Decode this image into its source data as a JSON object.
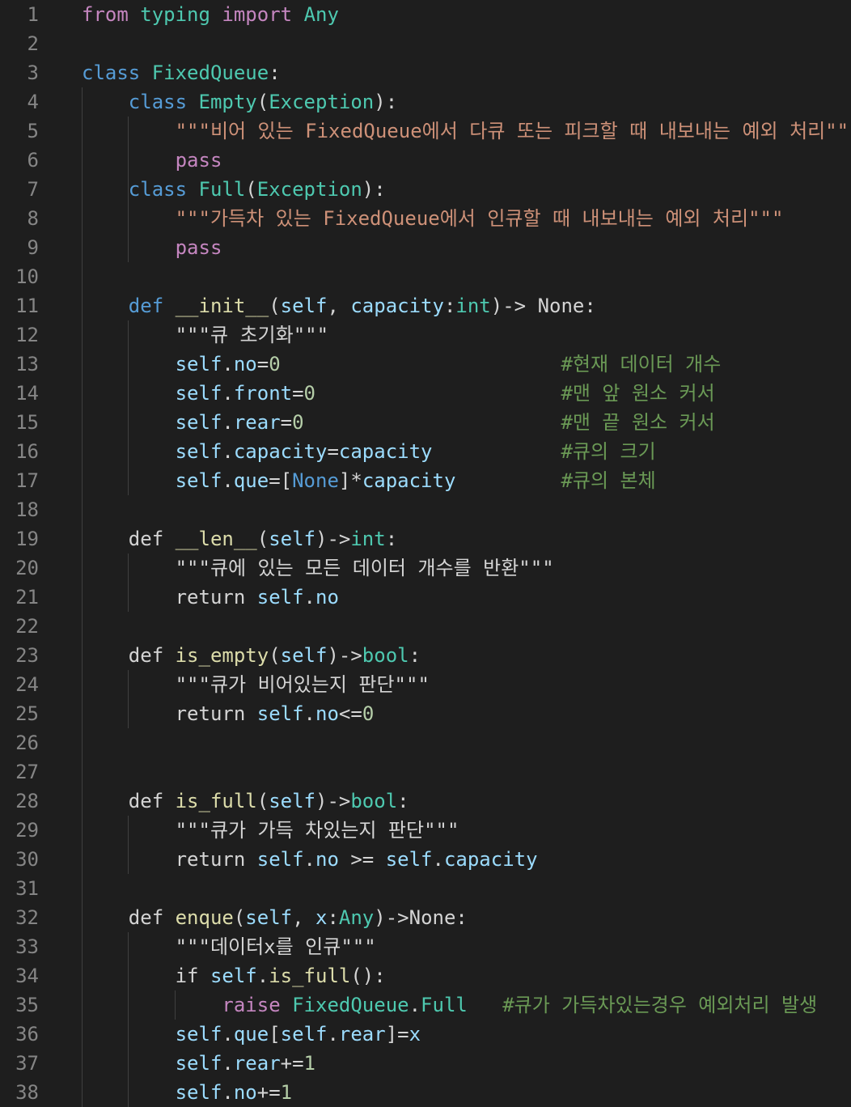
{
  "editor": {
    "colors": {
      "background": "#1e1e1e",
      "line_number": "#858585",
      "keyword_control": "#c586c0",
      "keyword": "#569cd6",
      "class_name": "#4ec9b0",
      "function_name": "#dcdcaa",
      "string": "#ce9178",
      "variable": "#9cdcfe",
      "number": "#b5cea8",
      "comment": "#6a9955",
      "default_text": "#d4d4d4"
    },
    "lines": [
      {
        "n": "1",
        "tokens": [
          [
            "kw-ctrl",
            "from"
          ],
          [
            "plain",
            " "
          ],
          [
            "cls",
            "typing"
          ],
          [
            "plain",
            " "
          ],
          [
            "kw-ctrl",
            "import"
          ],
          [
            "plain",
            " "
          ],
          [
            "cls",
            "Any"
          ]
        ]
      },
      {
        "n": "2",
        "tokens": []
      },
      {
        "n": "3",
        "tokens": [
          [
            "kw",
            "class"
          ],
          [
            "plain",
            " "
          ],
          [
            "cls",
            "FixedQueue"
          ],
          [
            "plain",
            ":"
          ]
        ]
      },
      {
        "n": "4",
        "tokens": [
          [
            "plain",
            "    "
          ],
          [
            "kw",
            "class"
          ],
          [
            "plain",
            " "
          ],
          [
            "cls",
            "Empty"
          ],
          [
            "plain",
            "("
          ],
          [
            "cls",
            "Exception"
          ],
          [
            "plain",
            "):"
          ]
        ]
      },
      {
        "n": "5",
        "tokens": [
          [
            "plain",
            "        "
          ],
          [
            "str",
            "\"\"\"비어 있는 FixedQueue에서 다큐 또는 피크할 때 내보내는 예외 처리\"\"\""
          ]
        ]
      },
      {
        "n": "6",
        "tokens": [
          [
            "plain",
            "        "
          ],
          [
            "kw-ctrl",
            "pass"
          ]
        ]
      },
      {
        "n": "7",
        "tokens": [
          [
            "plain",
            "    "
          ],
          [
            "kw",
            "class"
          ],
          [
            "plain",
            " "
          ],
          [
            "cls",
            "Full"
          ],
          [
            "plain",
            "("
          ],
          [
            "cls",
            "Exception"
          ],
          [
            "plain",
            "):"
          ]
        ]
      },
      {
        "n": "8",
        "tokens": [
          [
            "plain",
            "        "
          ],
          [
            "str",
            "\"\"\"가득차 있는 FixedQueue에서 인큐할 때 내보내는 예외 처리\"\"\""
          ]
        ]
      },
      {
        "n": "9",
        "tokens": [
          [
            "plain",
            "        "
          ],
          [
            "kw-ctrl",
            "pass"
          ]
        ]
      },
      {
        "n": "10",
        "tokens": []
      },
      {
        "n": "11",
        "tokens": [
          [
            "plain",
            "    "
          ],
          [
            "kw",
            "def"
          ],
          [
            "plain",
            " "
          ],
          [
            "fn",
            "__init__"
          ],
          [
            "plain",
            "("
          ],
          [
            "var",
            "self"
          ],
          [
            "plain",
            ", "
          ],
          [
            "var",
            "capacity"
          ],
          [
            "plain",
            ":"
          ],
          [
            "cls",
            "int"
          ],
          [
            "plain",
            ")-> None:"
          ]
        ]
      },
      {
        "n": "12",
        "tokens": [
          [
            "plain",
            "        "
          ],
          [
            "plain",
            "\"\"\"큐 초기화\"\"\""
          ]
        ]
      },
      {
        "n": "13",
        "tokens": [
          [
            "plain",
            "        "
          ],
          [
            "var",
            "self"
          ],
          [
            "plain",
            "."
          ],
          [
            "var",
            "no"
          ],
          [
            "plain",
            "="
          ],
          [
            "num",
            "0"
          ],
          [
            "plain",
            "                        "
          ],
          [
            "cmt",
            "#현재 데이터 개수"
          ]
        ]
      },
      {
        "n": "14",
        "tokens": [
          [
            "plain",
            "        "
          ],
          [
            "var",
            "self"
          ],
          [
            "plain",
            "."
          ],
          [
            "var",
            "front"
          ],
          [
            "plain",
            "="
          ],
          [
            "num",
            "0"
          ],
          [
            "plain",
            "                     "
          ],
          [
            "cmt",
            "#맨 앞 원소 커서"
          ]
        ]
      },
      {
        "n": "15",
        "tokens": [
          [
            "plain",
            "        "
          ],
          [
            "var",
            "self"
          ],
          [
            "plain",
            "."
          ],
          [
            "var",
            "rear"
          ],
          [
            "plain",
            "="
          ],
          [
            "num",
            "0"
          ],
          [
            "plain",
            "                      "
          ],
          [
            "cmt",
            "#맨 끝 원소 커서"
          ]
        ]
      },
      {
        "n": "16",
        "tokens": [
          [
            "plain",
            "        "
          ],
          [
            "var",
            "self"
          ],
          [
            "plain",
            "."
          ],
          [
            "var",
            "capacity"
          ],
          [
            "plain",
            "="
          ],
          [
            "var",
            "capacity"
          ],
          [
            "plain",
            "           "
          ],
          [
            "cmt",
            "#큐의 크기"
          ]
        ]
      },
      {
        "n": "17",
        "tokens": [
          [
            "plain",
            "        "
          ],
          [
            "var",
            "self"
          ],
          [
            "plain",
            "."
          ],
          [
            "var",
            "que"
          ],
          [
            "plain",
            "=["
          ],
          [
            "kw",
            "None"
          ],
          [
            "plain",
            "]*"
          ],
          [
            "var",
            "capacity"
          ],
          [
            "plain",
            "         "
          ],
          [
            "cmt",
            "#큐의 본체"
          ]
        ]
      },
      {
        "n": "18",
        "tokens": []
      },
      {
        "n": "19",
        "tokens": [
          [
            "plain",
            "    "
          ],
          [
            "plain",
            "def "
          ],
          [
            "fn",
            "__len__"
          ],
          [
            "plain",
            "("
          ],
          [
            "var",
            "self"
          ],
          [
            "plain",
            ")->"
          ],
          [
            "cls",
            "int"
          ],
          [
            "plain",
            ":"
          ]
        ]
      },
      {
        "n": "20",
        "tokens": [
          [
            "plain",
            "        "
          ],
          [
            "plain",
            "\"\"\"큐에 있는 모든 데이터 개수를 반환\"\"\""
          ]
        ]
      },
      {
        "n": "21",
        "tokens": [
          [
            "plain",
            "        "
          ],
          [
            "plain",
            "return "
          ],
          [
            "var",
            "self"
          ],
          [
            "plain",
            "."
          ],
          [
            "var",
            "no"
          ]
        ]
      },
      {
        "n": "22",
        "tokens": []
      },
      {
        "n": "23",
        "tokens": [
          [
            "plain",
            "    "
          ],
          [
            "plain",
            "def "
          ],
          [
            "fn",
            "is_empty"
          ],
          [
            "plain",
            "("
          ],
          [
            "var",
            "self"
          ],
          [
            "plain",
            ")->"
          ],
          [
            "cls",
            "bool"
          ],
          [
            "plain",
            ":"
          ]
        ]
      },
      {
        "n": "24",
        "tokens": [
          [
            "plain",
            "        "
          ],
          [
            "plain",
            "\"\"\"큐가 비어있는지 판단\"\"\""
          ]
        ]
      },
      {
        "n": "25",
        "tokens": [
          [
            "plain",
            "        "
          ],
          [
            "plain",
            "return "
          ],
          [
            "var",
            "self"
          ],
          [
            "plain",
            "."
          ],
          [
            "var",
            "no"
          ],
          [
            "plain",
            "<="
          ],
          [
            "num",
            "0"
          ]
        ]
      },
      {
        "n": "26",
        "tokens": []
      },
      {
        "n": "27",
        "tokens": []
      },
      {
        "n": "28",
        "tokens": [
          [
            "plain",
            "    "
          ],
          [
            "plain",
            "def "
          ],
          [
            "fn",
            "is_full"
          ],
          [
            "plain",
            "("
          ],
          [
            "var",
            "self"
          ],
          [
            "plain",
            ")->"
          ],
          [
            "cls",
            "bool"
          ],
          [
            "plain",
            ":"
          ]
        ]
      },
      {
        "n": "29",
        "tokens": [
          [
            "plain",
            "        "
          ],
          [
            "plain",
            "\"\"\"큐가 가득 차있는지 판단\"\"\""
          ]
        ]
      },
      {
        "n": "30",
        "tokens": [
          [
            "plain",
            "        "
          ],
          [
            "plain",
            "return "
          ],
          [
            "var",
            "self"
          ],
          [
            "plain",
            "."
          ],
          [
            "var",
            "no"
          ],
          [
            "plain",
            " >= "
          ],
          [
            "var",
            "self"
          ],
          [
            "plain",
            "."
          ],
          [
            "var",
            "capacity"
          ]
        ]
      },
      {
        "n": "31",
        "tokens": []
      },
      {
        "n": "32",
        "tokens": [
          [
            "plain",
            "    "
          ],
          [
            "plain",
            "def "
          ],
          [
            "fn",
            "enque"
          ],
          [
            "plain",
            "("
          ],
          [
            "var",
            "self"
          ],
          [
            "plain",
            ", "
          ],
          [
            "var",
            "x"
          ],
          [
            "plain",
            ":"
          ],
          [
            "cls",
            "Any"
          ],
          [
            "plain",
            ")->None:"
          ]
        ]
      },
      {
        "n": "33",
        "tokens": [
          [
            "plain",
            "        "
          ],
          [
            "plain",
            "\"\"\"데이터x를 인큐\"\"\""
          ]
        ]
      },
      {
        "n": "34",
        "tokens": [
          [
            "plain",
            "        "
          ],
          [
            "plain",
            "if "
          ],
          [
            "var",
            "self"
          ],
          [
            "plain",
            "."
          ],
          [
            "fn",
            "is_full"
          ],
          [
            "plain",
            "():"
          ]
        ]
      },
      {
        "n": "35",
        "tokens": [
          [
            "plain",
            "            "
          ],
          [
            "kw-ctrl",
            "raise"
          ],
          [
            "plain",
            " "
          ],
          [
            "cls",
            "FixedQueue"
          ],
          [
            "plain",
            "."
          ],
          [
            "cls",
            "Full"
          ],
          [
            "plain",
            "   "
          ],
          [
            "cmt",
            "#큐가 가득차있는경우 예외처리 발생"
          ]
        ]
      },
      {
        "n": "36",
        "tokens": [
          [
            "plain",
            "        "
          ],
          [
            "var",
            "self"
          ],
          [
            "plain",
            "."
          ],
          [
            "var",
            "que"
          ],
          [
            "plain",
            "["
          ],
          [
            "var",
            "self"
          ],
          [
            "plain",
            "."
          ],
          [
            "var",
            "rear"
          ],
          [
            "plain",
            "]="
          ],
          [
            "var",
            "x"
          ]
        ]
      },
      {
        "n": "37",
        "tokens": [
          [
            "plain",
            "        "
          ],
          [
            "var",
            "self"
          ],
          [
            "plain",
            "."
          ],
          [
            "var",
            "rear"
          ],
          [
            "plain",
            "+="
          ],
          [
            "num",
            "1"
          ]
        ]
      },
      {
        "n": "38",
        "tokens": [
          [
            "plain",
            "        "
          ],
          [
            "var",
            "self"
          ],
          [
            "plain",
            "."
          ],
          [
            "var",
            "no"
          ],
          [
            "plain",
            "+="
          ],
          [
            "num",
            "1"
          ]
        ]
      }
    ]
  }
}
